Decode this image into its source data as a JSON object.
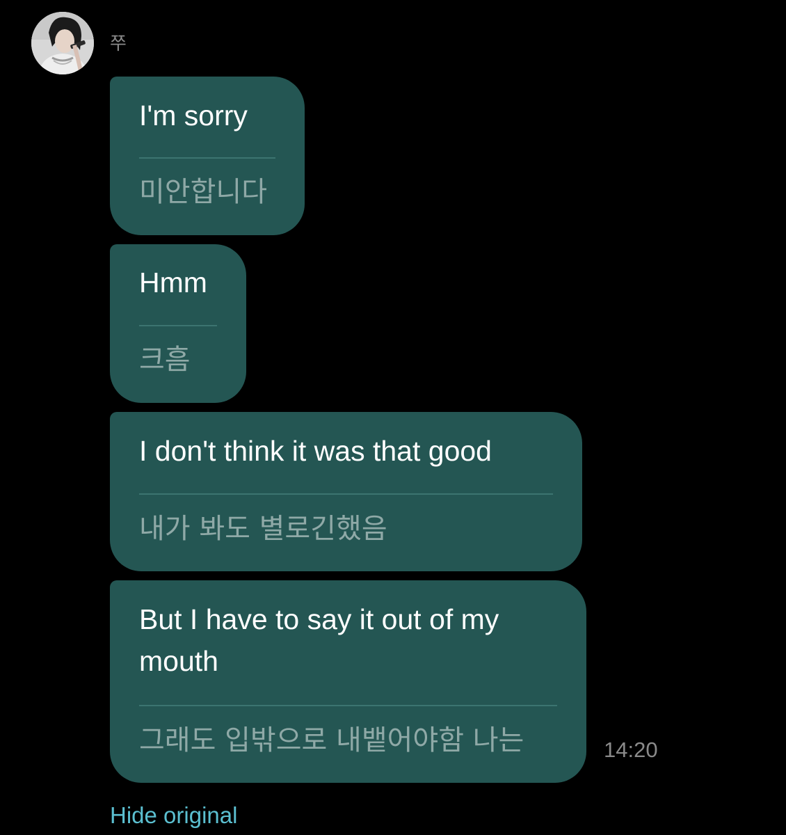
{
  "chat": {
    "sender": {
      "name": "쭈",
      "avatar_icon": "profile-photo"
    },
    "messages": [
      {
        "original": "I'm sorry",
        "translation": "미안합니다"
      },
      {
        "original": "Hmm",
        "translation": "크흠"
      },
      {
        "original": "I don't think it was that good",
        "translation": "내가 봐도 별로긴했음"
      },
      {
        "original": "But I have to say it out of my mouth",
        "translation": "그래도 입밖으로 내뱉어야함 나는"
      }
    ],
    "timestamp": "14:20",
    "hide_original_label": "Hide original"
  },
  "colors": {
    "background": "#000000",
    "bubble": "#245653",
    "divider": "#3c7470",
    "original_text": "#ffffff",
    "translation_text": "#8fa9a7",
    "link": "#5bbfd0",
    "meta_text": "#8a8a8a"
  }
}
